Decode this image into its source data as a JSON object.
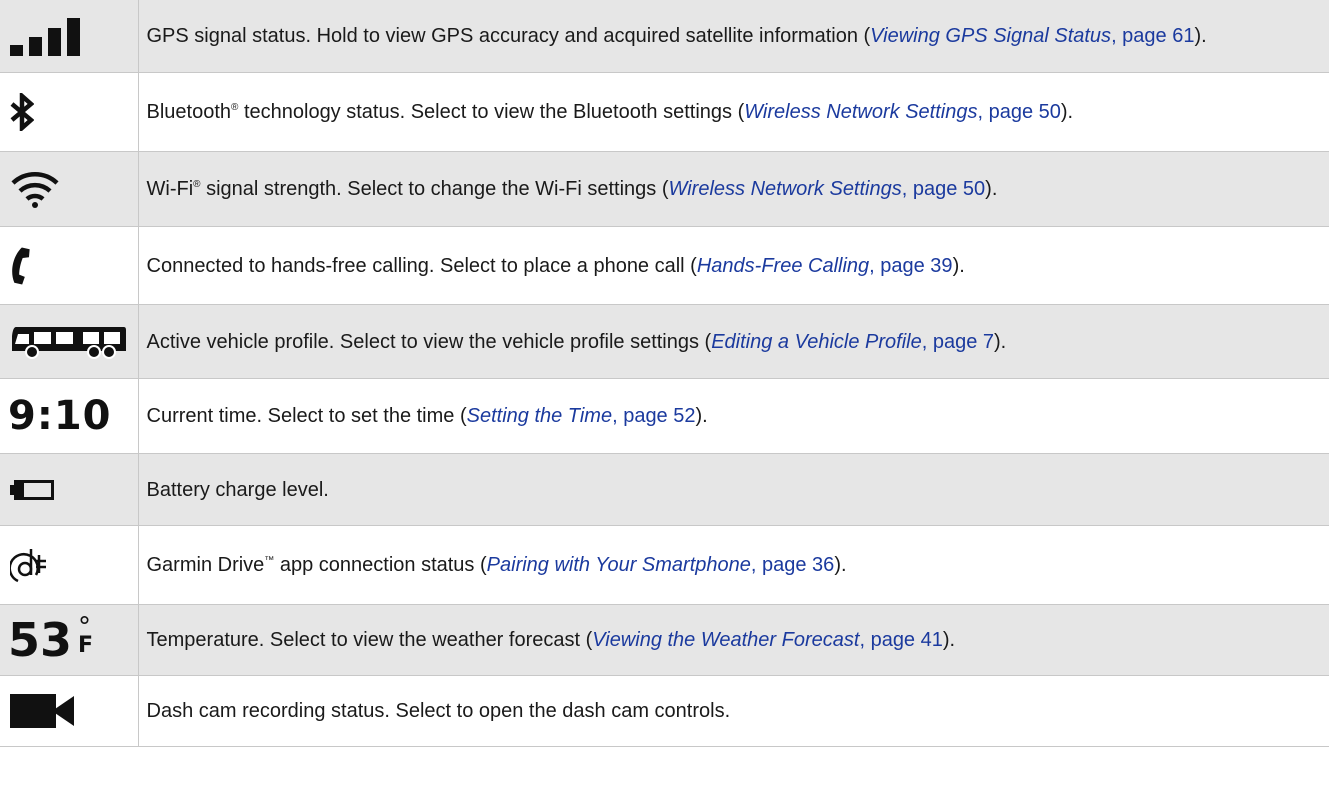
{
  "rows": [
    {
      "icon": "gps-signal-bars-icon",
      "text": "GPS signal status. Hold to view GPS accuracy and acquired satellite information (",
      "link": "Viewing GPS Signal Status",
      "page": ", page 61",
      "end": ")."
    },
    {
      "icon": "bluetooth-icon",
      "brand": "Bluetooth",
      "mark": "®",
      "text": " technology status. Select to view the Bluetooth settings (",
      "link": "Wireless Network Settings",
      "page": ", page 50",
      "end": ")."
    },
    {
      "icon": "wifi-icon",
      "brand": "Wi-Fi",
      "mark": "®",
      "text": " signal strength. Select to change the Wi-Fi settings (",
      "link": "Wireless Network Settings",
      "page": ", page 50",
      "end": ")."
    },
    {
      "icon": "phone-icon",
      "text": "Connected to hands-free calling. Select to place a phone call (",
      "link": "Hands-Free Calling",
      "page": ", page 39",
      "end": ")."
    },
    {
      "icon": "rv-vehicle-icon",
      "text": "Active vehicle profile. Select to view the vehicle profile settings (",
      "link": "Editing a Vehicle Profile",
      "page": ", page 7",
      "end": ")."
    },
    {
      "icon": "current-time-icon",
      "icon_text": "9:10",
      "text": "Current time. Select to set the time (",
      "link": "Setting the Time",
      "page": ", page 52",
      "end": ")."
    },
    {
      "icon": "battery-icon",
      "text": "Battery charge level."
    },
    {
      "icon": "garmin-drive-icon",
      "brand": "Garmin Drive",
      "mark": "™",
      "text": " app connection status (",
      "link": "Pairing with Your Smartphone",
      "page": ", page 36",
      "end": ")."
    },
    {
      "icon": "temperature-icon",
      "icon_text": "53",
      "icon_deg": "°",
      "icon_unit": "F",
      "text": "Temperature. Select to view the weather forecast (",
      "link": "Viewing the Weather Forecast",
      "page": ", page 41",
      "end": ")."
    },
    {
      "icon": "dash-cam-icon",
      "text": "Dash cam recording status. Select to open the dash cam controls."
    }
  ],
  "colors": {
    "link": "#1b3a9e",
    "row_shaded": "#e6e6e6",
    "row_plain": "#ffffff",
    "border": "#c8c8c8",
    "icon": "#111111"
  }
}
